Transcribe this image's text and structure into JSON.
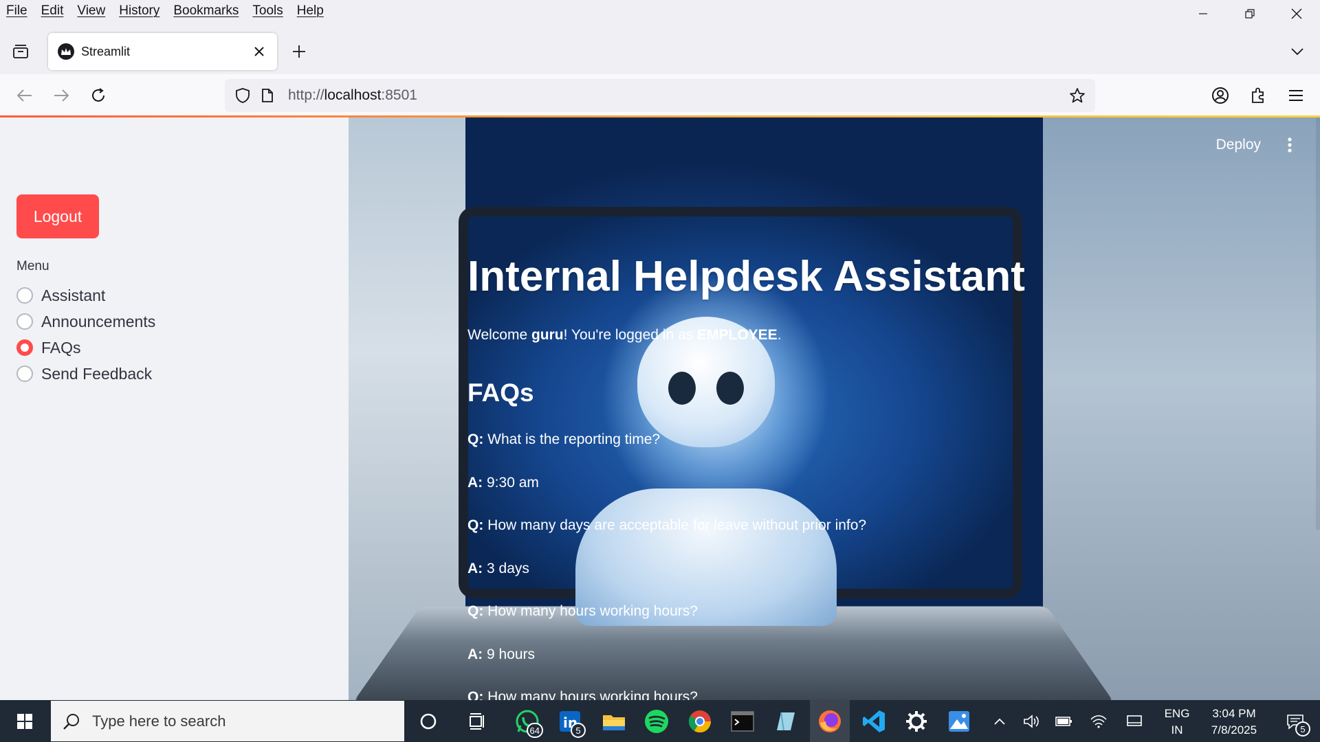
{
  "menubar": {
    "items": [
      "File",
      "Edit",
      "View",
      "History",
      "Bookmarks",
      "Tools",
      "Help"
    ]
  },
  "tab": {
    "title": "Streamlit"
  },
  "url": {
    "scheme": "http://",
    "host": "localhost",
    "port": ":8501"
  },
  "sidebar": {
    "logout_label": "Logout",
    "menu_label": "Menu",
    "options": [
      {
        "label": "Assistant",
        "selected": false
      },
      {
        "label": "Announcements",
        "selected": false
      },
      {
        "label": "FAQs",
        "selected": true
      },
      {
        "label": "Send Feedback",
        "selected": false
      }
    ]
  },
  "header": {
    "deploy_label": "Deploy"
  },
  "main": {
    "title": "Internal Helpdesk Assistant",
    "welcome_prefix": "Welcome ",
    "username": "guru",
    "welcome_middle": "! You're logged in as ",
    "role": "EMPLOYEE",
    "welcome_suffix": ".",
    "faq_heading": "FAQs",
    "faq_lines": [
      {
        "tag": "Q:",
        "text": " What is the reporting time?"
      },
      {
        "tag": "A:",
        "text": " 9:30 am"
      },
      {
        "tag": "Q:",
        "text": " How many days are acceptable for leave without prior info?"
      },
      {
        "tag": "A:",
        "text": " 3 days"
      },
      {
        "tag": "Q:",
        "text": " How many hours working hours?"
      },
      {
        "tag": "A:",
        "text": " 9 hours"
      },
      {
        "tag": "Q:",
        "text": " How many hours working hours?"
      }
    ]
  },
  "taskbar": {
    "search_placeholder": "Type here to search",
    "whatsapp_badge": "64",
    "linkedin_badge": "5",
    "lang_line1": "ENG",
    "lang_line2": "IN",
    "time": "3:04 PM",
    "date": "7/8/2025",
    "notification_count": "5"
  },
  "colors": {
    "accent": "#ff4b4b",
    "sidebar_bg": "#f0f2f6",
    "taskbar_bg": "#1f2a36"
  }
}
